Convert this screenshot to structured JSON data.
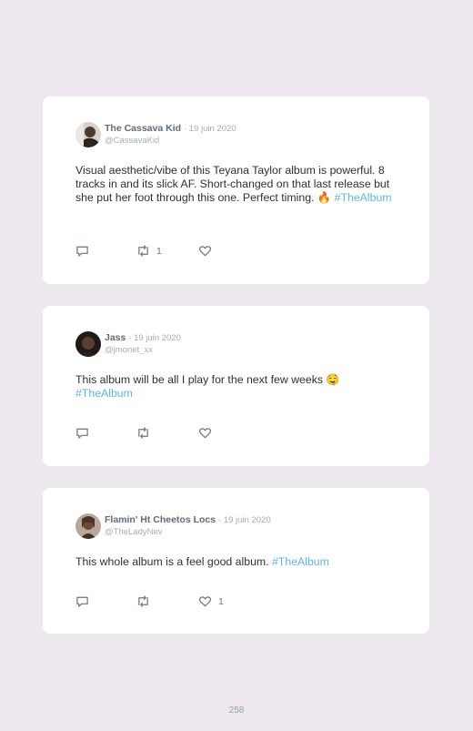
{
  "colors": {
    "background": "#ece8ee",
    "card": "#ffffff",
    "hashtag": "#5ab7e2",
    "icon": "#6b7680"
  },
  "tweets": [
    {
      "name": "The Cassava Kid",
      "date": "· 19 juin 2020",
      "handle": "@CassavaKid",
      "text": "Visual aesthetic/vibe of this Teyana Taylor album is powerful. 8 tracks in and its slick AF. Short-changed on that last release but she put her foot through this one. Perfect timing. 🔥",
      "hashtag": "#TheAlbum",
      "reply_count": "",
      "retweet_count": "1",
      "like_count": ""
    },
    {
      "name": "Jass",
      "date": "· 19 juin 2020",
      "handle": "@jmonet_xx",
      "text": "This album will be all I play for the next few weeks 🤤",
      "hashtag": "#TheAlbum",
      "reply_count": "",
      "retweet_count": "",
      "like_count": ""
    },
    {
      "name": "Flamin' Ht Cheetos Locs",
      "date": "· 19 juin 2020",
      "handle": "@TheLadyNev",
      "text": "This whole album is a feel good album.",
      "hashtag": "#TheAlbum",
      "reply_count": "",
      "retweet_count": "",
      "like_count": "1"
    }
  ],
  "page_number": "258"
}
